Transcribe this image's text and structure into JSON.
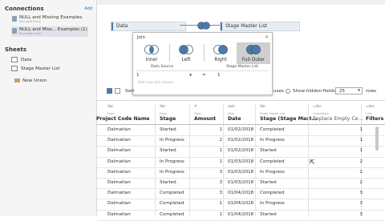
{
  "sidebar": {
    "connections_title": "Connections",
    "add_label": "Add",
    "connections": [
      {
        "name": "NULL and Missing Examples",
        "subtitle": "Microsoft Excel",
        "selected": false
      },
      {
        "name": "NULL and Miss... Examples (1)",
        "subtitle": "Microsoft Excel",
        "selected": true
      }
    ],
    "sheets_title": "Sheets",
    "sheets": [
      "Data",
      "Stage Master List"
    ],
    "new_union": "New Union"
  },
  "canvas": {
    "left_table": "Data",
    "right_table": "Stage Master List"
  },
  "join_dialog": {
    "title": "Join",
    "close": "×",
    "types": [
      {
        "label": "Inner",
        "selected": false
      },
      {
        "label": "Left",
        "selected": false
      },
      {
        "label": "Right",
        "selected": false
      },
      {
        "label": "Full Outer",
        "selected": true
      }
    ],
    "left_header": "Data Source",
    "right_header": "Stage Master List",
    "left_field": "1",
    "operator": "=",
    "right_field": "1",
    "add_clause": "Add new join clause"
  },
  "toolbar": {
    "sort_prefix": "Sort",
    "uses_suffix": "uses",
    "show_hidden_label": "Show hidden fields",
    "rows_value": "25",
    "rows_label": "rows"
  },
  "grid": {
    "columns": [
      {
        "type": "Abc",
        "source": "Data",
        "name": "Project Code Name"
      },
      {
        "type": "Abc",
        "source": "Data",
        "name": "Stage"
      },
      {
        "type": "#",
        "source": "Data",
        "name": "Amount"
      },
      {
        "type": "date",
        "source": "Data",
        "name": "Date"
      },
      {
        "type": "Abc",
        "source": "Stage Master List",
        "name": "Stage (Stage Mast..."
      },
      {
        "type": "=Abc",
        "source": "Calculation",
        "name": "Replace Empty Ce..."
      },
      {
        "type": "=Abc",
        "source": "Calc",
        "name": "Filters"
      }
    ],
    "rows": [
      [
        "Dalmatian",
        "Started",
        "1",
        "01/02/2018",
        "Completed",
        "",
        "1"
      ],
      [
        "Dalmatian",
        "In Progress",
        "2",
        "01/02/2018",
        "In Progress",
        "",
        "1"
      ],
      [
        "Dalmatian",
        "Started",
        "1",
        "01/02/2018",
        "Started",
        "",
        "1"
      ],
      [
        "Dalmatian",
        "In Progress",
        "1",
        "01/03/2018",
        "Completed",
        "",
        "2"
      ],
      [
        "Dalmatian",
        "In Progress",
        "3",
        "01/03/2018",
        "In Progress",
        "",
        "2"
      ],
      [
        "Dalmatian",
        "Started",
        "3",
        "01/03/2018",
        "Started",
        "",
        "2"
      ],
      [
        "Dalmatian",
        "Completed",
        "3",
        "01/04/2018",
        "Completed",
        "",
        "3"
      ],
      [
        "Dalmatian",
        "Completed",
        "1",
        "01/04/2018",
        "In Progress",
        "",
        "3"
      ],
      [
        "Dalmatian",
        "Completed",
        "1",
        "01/04/2018",
        "Started",
        "",
        "3"
      ]
    ]
  },
  "colors": {
    "accent": "#4e79a7",
    "selected_bg": "#dfe3e8",
    "join_selected": "#cfcfcf"
  }
}
